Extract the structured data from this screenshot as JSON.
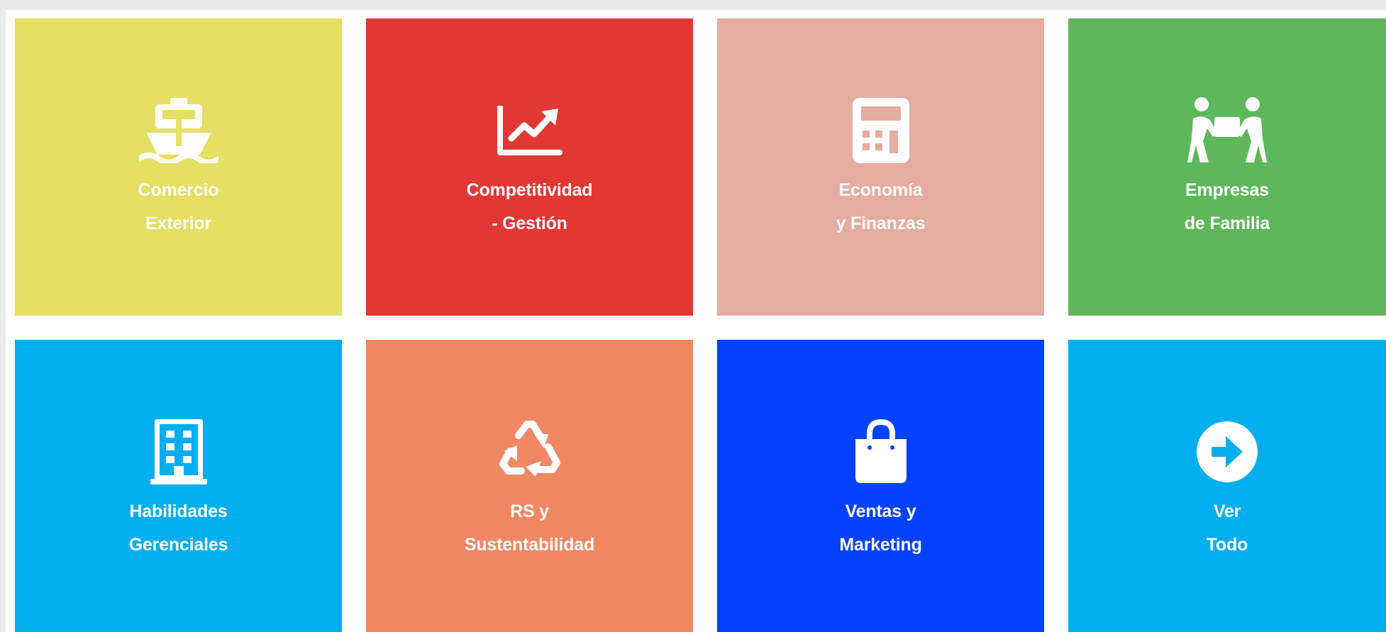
{
  "tiles": [
    {
      "line1": "Comercio",
      "line2": "Exterior",
      "icon": "ship-icon",
      "color": "#e5df63"
    },
    {
      "line1": "Competitividad",
      "line2": "- Gestión",
      "icon": "chart-line-icon",
      "color": "#e33734"
    },
    {
      "line1": "Economía",
      "line2": "y Finanzas",
      "icon": "calculator-icon",
      "color": "#e5aca1"
    },
    {
      "line1": "Empresas",
      "line2": "de Familia",
      "icon": "people-carry-icon",
      "color": "#5fb75c"
    },
    {
      "line1": "Habilidades",
      "line2": "Gerenciales",
      "icon": "building-icon",
      "color": "#02aeef"
    },
    {
      "line1": "RS y",
      "line2": "Sustentabilidad",
      "icon": "recycle-icon",
      "color": "#ef8863"
    },
    {
      "line1": "Ventas y",
      "line2": "Marketing",
      "icon": "shopping-bag-icon",
      "color": "#0242fe"
    },
    {
      "line1": "Ver",
      "line2": "Todo",
      "icon": "arrow-circle-right-icon",
      "color": "#02aeef"
    }
  ]
}
